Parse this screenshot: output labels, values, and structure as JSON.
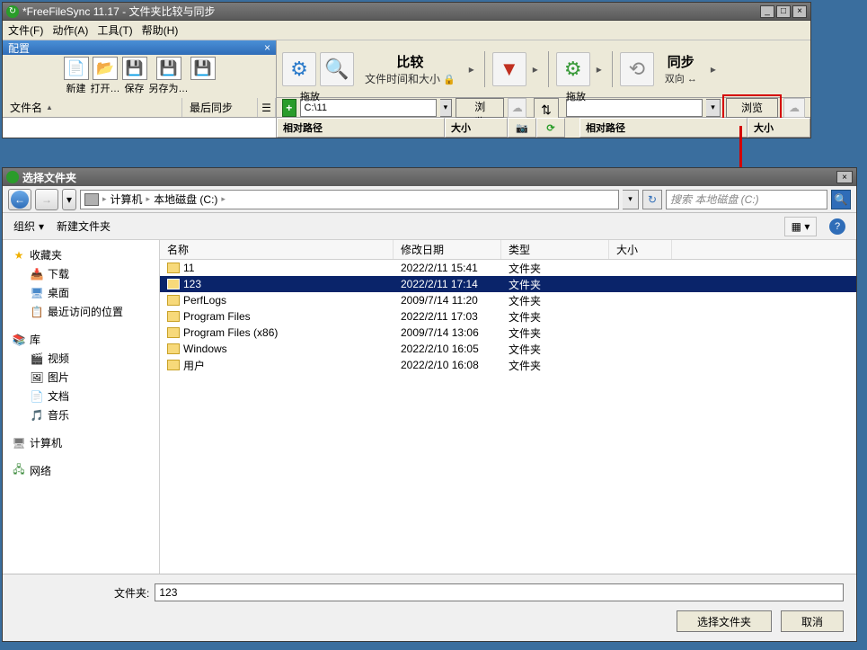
{
  "ffs": {
    "title": "*FreeFileSync 11.17 - 文件夹比较与同步",
    "menu": {
      "file": "文件(F)",
      "action": "动作(A)",
      "tool": "工具(T)",
      "help": "帮助(H)"
    },
    "config": {
      "header": "配置",
      "new": "新建",
      "open": "打开…",
      "save": "保存",
      "saveas": "另存为…"
    },
    "compare": {
      "label": "比较",
      "mode": "文件时间和大小"
    },
    "sync": {
      "label": "同步",
      "mode": "双向 ↔"
    },
    "dragdrop": "拖放",
    "leftPath": "C:\\11",
    "rightPath": "",
    "browse": "浏览",
    "fileName": "文件名",
    "lastSync": "最后同步",
    "relPath": "相对路径",
    "size": "大小"
  },
  "dlg": {
    "title": "选择文件夹",
    "breadcrumb": {
      "computer": "计算机",
      "disk": "本地磁盘 (C:)"
    },
    "searchPlaceholder": "搜索 本地磁盘 (C:)",
    "organize": "组织",
    "newFolder": "新建文件夹",
    "cols": {
      "name": "名称",
      "date": "修改日期",
      "type": "类型",
      "size": "大小"
    },
    "sidebar": {
      "fav": "收藏夹",
      "downloads": "下载",
      "desktop": "桌面",
      "recent": "最近访问的位置",
      "lib": "库",
      "video": "视频",
      "pic": "图片",
      "doc": "文档",
      "music": "音乐",
      "computer": "计算机",
      "network": "网络"
    },
    "files": [
      {
        "name": "11",
        "date": "2022/2/11 15:41",
        "type": "文件夹"
      },
      {
        "name": "123",
        "date": "2022/2/11 17:14",
        "type": "文件夹",
        "selected": true
      },
      {
        "name": "PerfLogs",
        "date": "2009/7/14 11:20",
        "type": "文件夹"
      },
      {
        "name": "Program Files",
        "date": "2022/2/11 17:03",
        "type": "文件夹"
      },
      {
        "name": "Program Files (x86)",
        "date": "2009/7/14 13:06",
        "type": "文件夹"
      },
      {
        "name": "Windows",
        "date": "2022/2/10 16:05",
        "type": "文件夹"
      },
      {
        "name": "用户",
        "date": "2022/2/10 16:08",
        "type": "文件夹"
      }
    ],
    "folderLabel": "文件夹:",
    "folderValue": "123",
    "select": "选择文件夹",
    "cancel": "取消"
  }
}
